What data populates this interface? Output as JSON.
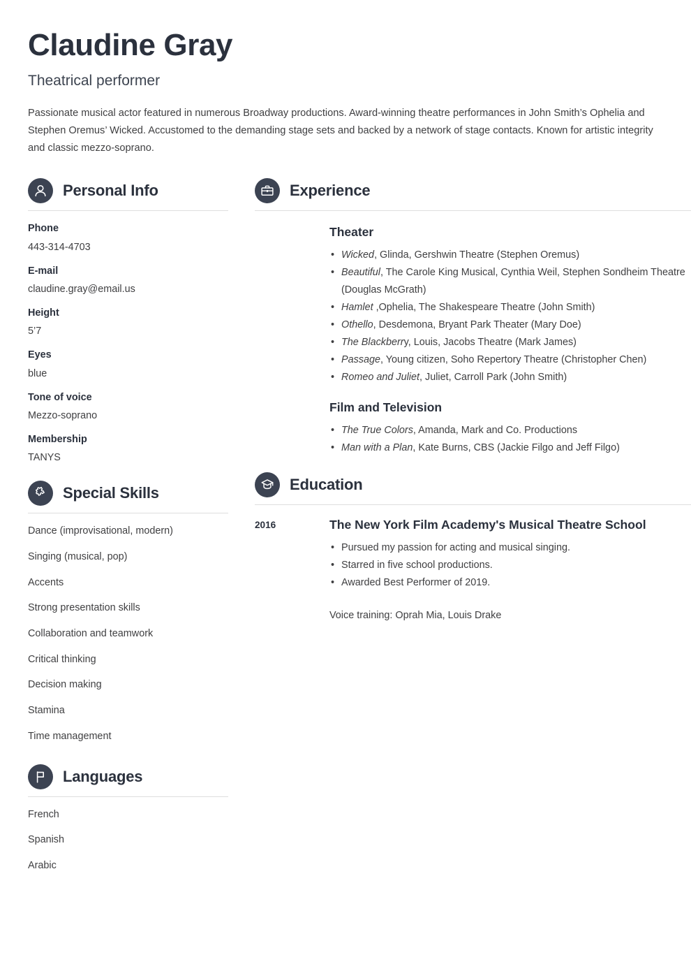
{
  "header": {
    "name": "Claudine Gray",
    "job_title": "Theatrical performer",
    "summary": "Passionate musical actor featured in numerous Broadway productions. Award-winning theatre performances in John Smith’s Ophelia and Stephen Oremus’ Wicked. Accustomed to the demanding stage sets and backed by a network of stage contacts. Known for artistic integrity and classic mezzo-soprano."
  },
  "colors": {
    "icon_circle": "#3c4352",
    "heading": "#2b313d",
    "body_text": "#3f3f41",
    "rule": "#dedede",
    "background": "#ffffff"
  },
  "personal_info": {
    "section_title": "Personal Info",
    "icon": "person-icon",
    "items": [
      {
        "label": "Phone",
        "value": "443-314-4703"
      },
      {
        "label": "E-mail",
        "value": "claudine.gray@email.us"
      },
      {
        "label": "Height",
        "value": "5’7"
      },
      {
        "label": "Eyes",
        "value": "blue"
      },
      {
        "label": "Tone of voice",
        "value": "Mezzo-soprano"
      },
      {
        "label": "Membership",
        "value": "TANYS"
      }
    ]
  },
  "special_skills": {
    "section_title": "Special Skills",
    "icon": "puzzle-piece-icon",
    "items": [
      "Dance (improvisational, modern)",
      "Singing (musical, pop)",
      "Accents",
      "Strong presentation skills",
      "Collaboration and teamwork",
      "Critical thinking",
      "Decision making",
      "Stamina",
      "Time management"
    ]
  },
  "languages": {
    "section_title": "Languages",
    "icon": "flag-icon",
    "items": [
      "French",
      "Spanish",
      "Arabic"
    ]
  },
  "experience": {
    "section_title": "Experience",
    "icon": "briefcase-icon",
    "groups": [
      {
        "heading": "Theater",
        "entries": [
          {
            "title": "Wicked",
            "rest": ", Glinda, Gershwin Theatre (Stephen Oremus)"
          },
          {
            "title": "Beautiful",
            "rest": ", The Carole King Musical, Cynthia Weil, Stephen Sondheim Theatre (Douglas McGrath)"
          },
          {
            "title": "Hamlet",
            "rest": " ,Ophelia, The Shakespeare Theatre (John Smith)"
          },
          {
            "title": "Othello",
            "rest": ", Desdemona, Bryant Park Theater (Mary Doe)"
          },
          {
            "title": "The Blackberr",
            "rest": "y, Louis, Jacobs Theatre (Mark James)"
          },
          {
            "title": "Passage",
            "rest": ", Young citizen, Soho Repertory Theatre (Christopher Chen)"
          },
          {
            "title": "Romeo and Juliet",
            "rest": ", Juliet, Carroll Park (John Smith)"
          }
        ]
      },
      {
        "heading": "Film and Television",
        "entries": [
          {
            "title": "The True Colors",
            "rest": ", Amanda, Mark and Co. Productions"
          },
          {
            "title": "Man with a Plan",
            "rest": ", Kate Burns, CBS (Jackie Filgo and Jeff Filgo)"
          }
        ]
      }
    ]
  },
  "education": {
    "section_title": "Education",
    "icon": "graduation-cap-icon",
    "entries": [
      {
        "year": "2016",
        "school": "The New York Film Academy's Musical Theatre School",
        "bullets": [
          "Pursued my passion for acting and musical singing.",
          "Starred in five school productions.",
          "Awarded Best Performer of 2019."
        ],
        "note": "Voice training: Oprah Mia, Louis Drake"
      }
    ]
  }
}
